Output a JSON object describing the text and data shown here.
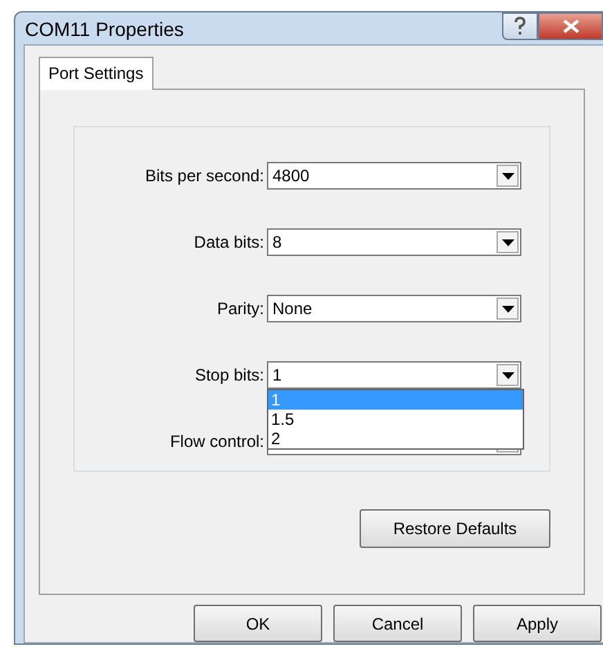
{
  "window": {
    "title": "COM11 Properties"
  },
  "tabs": [
    {
      "label": "Port Settings",
      "selected": true
    }
  ],
  "settings": [
    {
      "label": "Bits per second:",
      "value": "4800"
    },
    {
      "label": "Data bits:",
      "value": "8"
    },
    {
      "label": "Parity:",
      "value": "None"
    },
    {
      "label": "Stop bits:",
      "value": "1",
      "options": [
        {
          "label": "1",
          "selected": true
        },
        {
          "label": "1.5",
          "selected": false
        },
        {
          "label": "2",
          "selected": false
        }
      ]
    },
    {
      "label": "Flow control:"
    }
  ],
  "restore_button": "Restore Defaults",
  "buttons": [
    "OK",
    "Cancel",
    "Apply"
  ]
}
